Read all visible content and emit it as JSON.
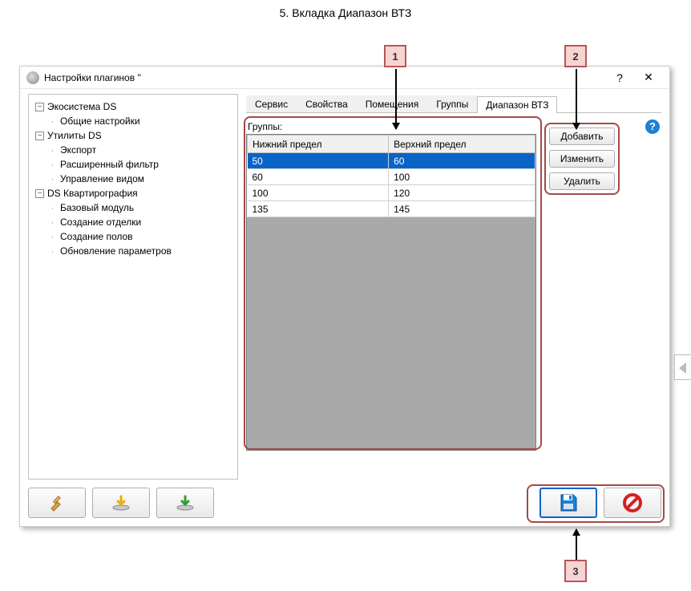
{
  "doc_title": "5. Вкладка Диапазон ВТЗ",
  "callouts": {
    "c1": "1",
    "c2": "2",
    "c3": "3"
  },
  "window": {
    "title": "Настройки плагинов ''",
    "help_btn": "?",
    "close_btn": "✕"
  },
  "tree": {
    "n0": {
      "label": "Экосистема DS",
      "toggle": "−"
    },
    "n0_0": {
      "label": "Общие настройки"
    },
    "n1": {
      "label": "Утилиты DS",
      "toggle": "−"
    },
    "n1_0": {
      "label": "Экспорт"
    },
    "n1_1": {
      "label": "Расширенный фильтр"
    },
    "n1_2": {
      "label": "Управление видом"
    },
    "n2": {
      "label": "DS Квартирография",
      "toggle": "−"
    },
    "n2_0": {
      "label": "Базовый модуль"
    },
    "n2_1": {
      "label": "Создание отделки"
    },
    "n2_2": {
      "label": "Создание полов"
    },
    "n2_3": {
      "label": "Обновление параметров"
    }
  },
  "tabs": {
    "t0": "Сервис",
    "t1": "Свойства",
    "t2": "Помещения",
    "t3": "Группы",
    "t4": "Диапазон ВТЗ"
  },
  "help_icon": "?",
  "group_label": "Группы:",
  "grid": {
    "col_lower": "Нижний предел",
    "col_upper": "Верхний предел",
    "rows": [
      {
        "lower": "50",
        "upper": "60"
      },
      {
        "lower": "60",
        "upper": "100"
      },
      {
        "lower": "100",
        "upper": "120"
      },
      {
        "lower": "135",
        "upper": "145"
      }
    ]
  },
  "buttons": {
    "add": "Добавить",
    "edit": "Изменить",
    "delete": "Удалить"
  }
}
